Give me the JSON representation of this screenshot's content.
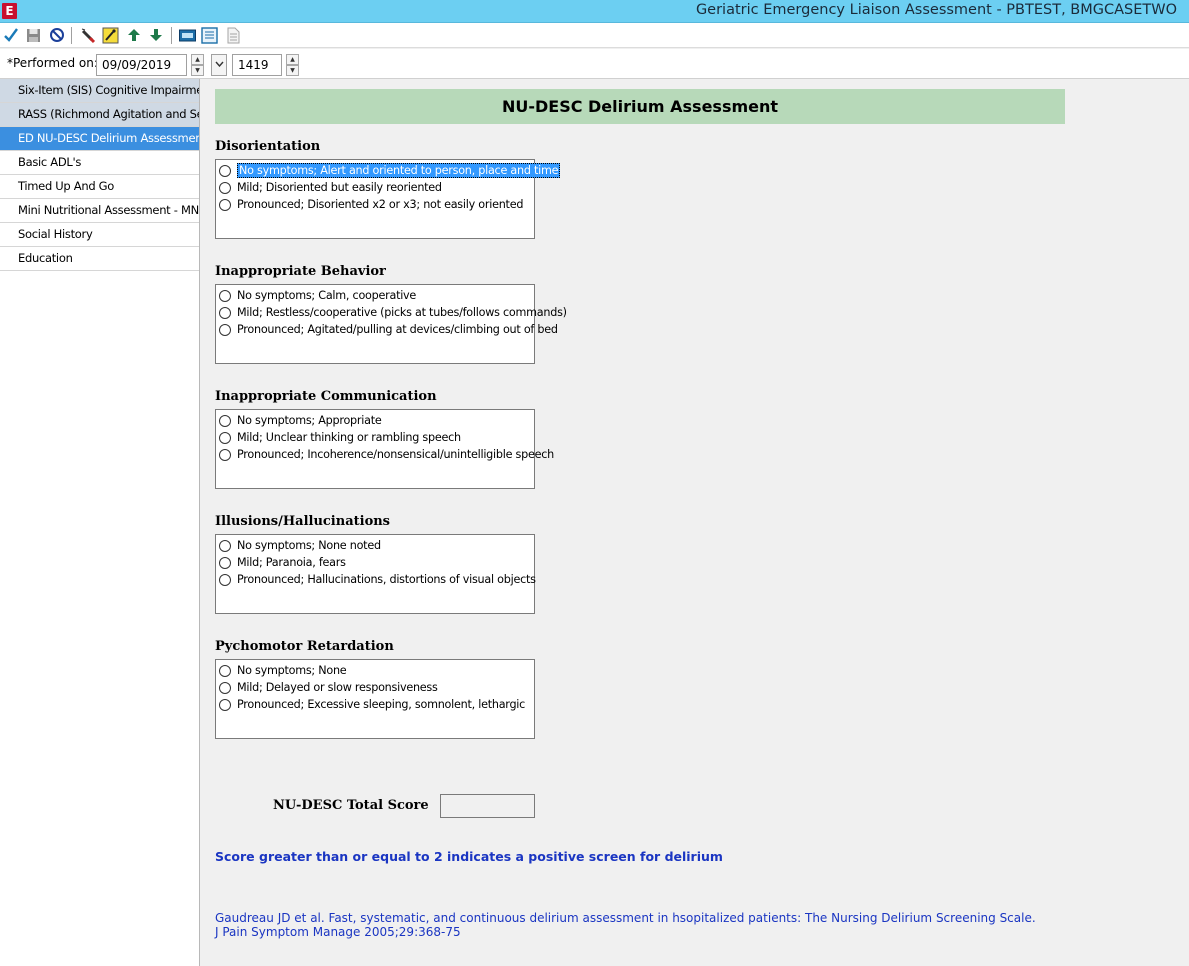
{
  "window": {
    "title": "Geriatric Emergency Liaison Assessment - PBTEST, BMGCASETWO",
    "app_icon": "E"
  },
  "toolbar": {
    "icons": [
      "checkmark-icon",
      "save-icon",
      "cancel-icon",
      "eraser-icon",
      "edit-icon",
      "up-arrow-icon",
      "down-arrow-icon",
      "keyboard-icon",
      "calendar-icon",
      "document-icon"
    ]
  },
  "performed": {
    "label": "*Performed on:",
    "date": "09/09/2019",
    "time": "1419"
  },
  "sidebar": {
    "items": [
      {
        "label": "Six-Item (SIS) Cognitive Impairment Screen",
        "state": "dim"
      },
      {
        "label": "RASS (Richmond Agitation and Sedation Scale)",
        "state": "dim"
      },
      {
        "label": "ED NU-DESC Delirium Assessment",
        "state": "active"
      },
      {
        "label": "Basic ADL's",
        "state": "normal"
      },
      {
        "label": "Timed Up And Go",
        "state": "normal"
      },
      {
        "label": "Mini Nutritional Assessment - MNA",
        "state": "normal"
      },
      {
        "label": "Social History",
        "state": "normal"
      },
      {
        "label": "Education",
        "state": "normal"
      }
    ]
  },
  "form": {
    "title": "NU-DESC Delirium Assessment",
    "sections": [
      {
        "label": "Disorientation",
        "options": [
          "No symptoms; Alert and oriented to person, place and time",
          "Mild; Disoriented but easily reoriented",
          "Pronounced; Disoriented x2 or x3; not easily oriented"
        ]
      },
      {
        "label": "Inappropriate Behavior",
        "options": [
          "No symptoms; Calm, cooperative",
          "Mild; Restless/cooperative (picks at tubes/follows commands)",
          "Pronounced; Agitated/pulling at devices/climbing out of bed"
        ]
      },
      {
        "label": "Inappropriate Communication",
        "options": [
          "No symptoms; Appropriate",
          "Mild; Unclear thinking or rambling speech",
          "Pronounced; Incoherence/nonsensical/unintelligible speech"
        ]
      },
      {
        "label": "Illusions/Hallucinations",
        "options": [
          "No symptoms; None noted",
          "Mild; Paranoia, fears",
          "Pronounced; Hallucinations, distortions of visual objects"
        ]
      },
      {
        "label": "Pychomotor Retardation",
        "options": [
          "No symptoms; None",
          "Mild; Delayed or slow responsiveness",
          "Pronounced; Excessive sleeping, somnolent, lethargic"
        ]
      }
    ],
    "total_label": "NU-DESC Total Score",
    "total_value": "",
    "note": "Score greater than or equal to 2 indicates a positive screen for delirium",
    "reference_line1": "Gaudreau JD et al. Fast, systematic, and continuous delirium assessment in hsopitalized patients:  The Nursing Delirium Screening Scale.",
    "reference_line2": "J Pain Symptom Manage 2005;29:368-75"
  }
}
